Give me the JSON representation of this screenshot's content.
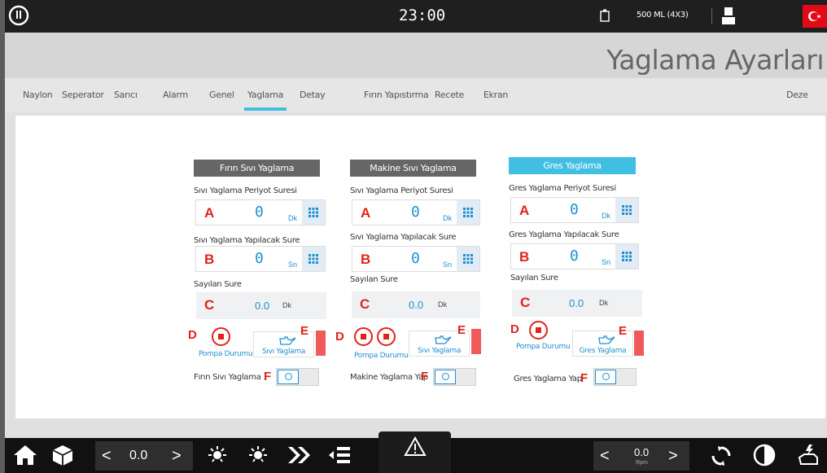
{
  "topbar": {
    "clock": "23:00",
    "bottle_label": "500 ML (4X3)",
    "flag_colors": "#e30a17"
  },
  "header": {
    "title": "Yaglama Ayarları"
  },
  "tabs": [
    {
      "label": "Naylon"
    },
    {
      "label": "Seperator"
    },
    {
      "label": "Sarıcı"
    },
    {
      "label": "Alarm"
    },
    {
      "label": "Genel"
    },
    {
      "label": "Yaglama",
      "active": true
    },
    {
      "label": "Detay"
    },
    {
      "label": "Fırın Yapıstırma"
    },
    {
      "label": "Recete"
    },
    {
      "label": "Ekran"
    },
    {
      "label": "Deze"
    }
  ],
  "columns": [
    {
      "title": "Fırın Sıvı Yaglama",
      "title_color": "#666666",
      "period_label": "Sıvı Yaglama Periyot Suresi",
      "period_letter": "A",
      "period_value": "0",
      "period_unit": "Dk",
      "duration_label": "Sıvı Yaglama Yapılacak Sure",
      "duration_letter": "B",
      "duration_value": "0",
      "duration_unit": "Sn",
      "counted_label": "Sayılan Sure",
      "counted_letter": "C",
      "counted_value": "0.0",
      "counted_unit": "Dk",
      "pump_letter": "D",
      "pump_label": "Pompa Durumu",
      "oil_letter": "E",
      "oil_label": "Sıvı Yaglama",
      "toggle_label": "Fırın Sıvı Yaglama",
      "toggle_letter": "F"
    },
    {
      "title": "Makine Sıvı Yaglama",
      "title_color": "#666666",
      "period_label": "Sıvı Yaglama Periyot Suresi",
      "period_letter": "A",
      "period_value": "0",
      "period_unit": "Dk",
      "duration_label": "Sıvı Yaglama Yapılacak Sure",
      "duration_letter": "B",
      "duration_value": "0",
      "duration_unit": "Sn",
      "counted_label": "Sayılan Sure",
      "counted_letter": "C",
      "counted_value": "0.0",
      "counted_unit": "Dk",
      "pump_letter": "D",
      "pump_label": "Pompa Durumu",
      "oil_letter": "E",
      "oil_label": "Sıvı Yaglama",
      "toggle_label": "Makine Yaglama Yap",
      "toggle_letter": "F"
    },
    {
      "title": "Gres Yaglama",
      "title_color": "#41bfe3",
      "period_label": "Gres Yaglama Periyot Suresi",
      "period_letter": "A",
      "period_value": "0",
      "period_unit": "Dk",
      "duration_label": "Gres Yaglama Yapılacak Sure",
      "duration_letter": "B",
      "duration_value": "0",
      "duration_unit": "Sn",
      "counted_label": "Sayılan Sure",
      "counted_letter": "C",
      "counted_value": "0.0",
      "counted_unit": "Dk",
      "pump_letter": "D",
      "pump_label": "Pompa Durumu",
      "oil_letter": "E",
      "oil_label": "Gres Yaglama",
      "toggle_label": "Gres Yaglama Yap",
      "toggle_letter": "F"
    }
  ],
  "bottombar": {
    "left_value": "0.0",
    "right_value": "0.0",
    "right_unit": "Rpm",
    "prev_symbol": "<",
    "next_symbol": ">"
  }
}
